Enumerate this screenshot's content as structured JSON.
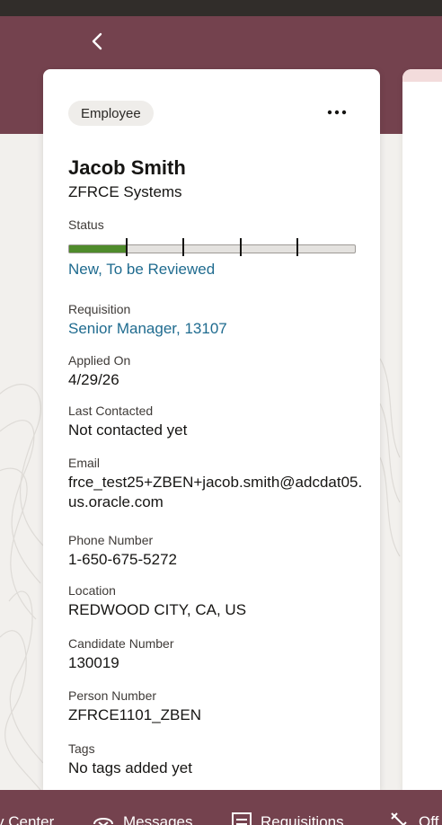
{
  "header": {
    "back_icon": "chevron-left-icon"
  },
  "candidate": {
    "badge": "Employee",
    "more_icon": "more-horizontal-icon",
    "name": "Jacob Smith",
    "company": "ZFRCE Systems",
    "status_label": "Status",
    "status_value": "New, To be Reviewed",
    "status_progress_fraction": 0.2,
    "status_steps": 5
  },
  "fields": [
    {
      "label": "Requisition",
      "value": "Senior Manager, 13107",
      "link": true
    },
    {
      "label": "Applied On",
      "value": "4/29/26",
      "link": false
    },
    {
      "label": "Last Contacted",
      "value": "Not contacted yet",
      "link": false
    },
    {
      "label": "Email",
      "value": "frce_test25+ZBEN+jacob.smith@adcdat05.us.oracle.com",
      "link": false
    },
    {
      "label": "Phone Number",
      "value": "1-650-675-5272",
      "link": false
    },
    {
      "label": "Location",
      "value": "REDWOOD CITY, CA, US",
      "link": false
    },
    {
      "label": "Candidate Number",
      "value": "130019",
      "link": false
    },
    {
      "label": "Person Number",
      "value": "ZFRCE1101_ZBEN",
      "link": false
    },
    {
      "label": "Tags",
      "value": "No tags added yet",
      "link": false
    }
  ],
  "bottom_nav": [
    {
      "label": "y Center",
      "icon": ""
    },
    {
      "label": "Messages",
      "icon": "messages-icon"
    },
    {
      "label": "Requisitions",
      "icon": "requisitions-icon"
    },
    {
      "label": "Off",
      "icon": "offers-icon"
    }
  ],
  "colors": {
    "brand": "#74424e",
    "link": "#1f6b8f",
    "progress": "#4f8b2b"
  }
}
